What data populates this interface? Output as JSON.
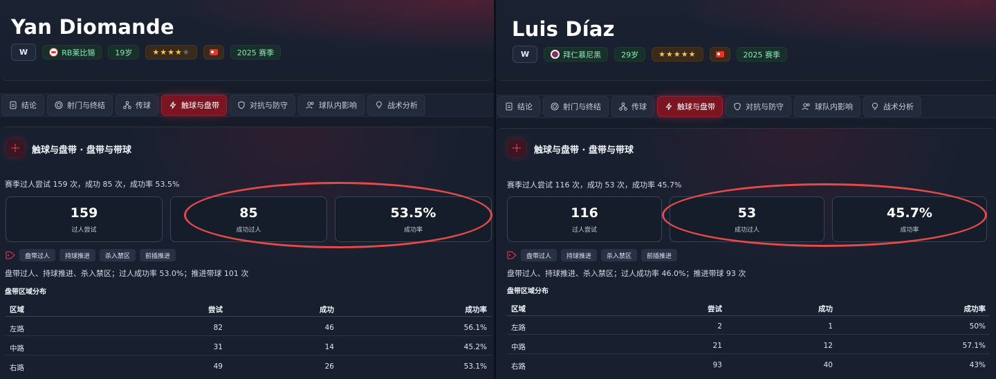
{
  "tabs": [
    {
      "label": "结论",
      "icon": "document-icon"
    },
    {
      "label": "射门与终结",
      "icon": "target-icon"
    },
    {
      "label": "传球",
      "icon": "network-icon"
    },
    {
      "label": "触球与盘带",
      "icon": "lightning-icon"
    },
    {
      "label": "对抗与防守",
      "icon": "shield-icon"
    },
    {
      "label": "球队内影响",
      "icon": "users-icon"
    },
    {
      "label": "战术分析",
      "icon": "lightbulb-icon"
    }
  ],
  "active_tab": "触球与盘带",
  "left": {
    "player": {
      "name": "Yan Diomande",
      "position": "W",
      "club": "RB莱比锡",
      "club_icon": "rb-leipzig-logo-icon",
      "age": "19岁",
      "rating_stars": 4,
      "rating_max": 5,
      "nationality_flag": "germany-flag-icon",
      "season": "2025 赛季"
    },
    "section": {
      "title": "触球与盘带 · 盘带与带球",
      "summary": "赛季过人尝试 159 次，成功 85 次，成功率 53.5%",
      "stats": [
        {
          "value": "159",
          "label": "过人尝试"
        },
        {
          "value": "85",
          "label": "成功过人"
        },
        {
          "value": "53.5%",
          "label": "成功率"
        }
      ],
      "tags": [
        "盘带过人",
        "持球推进",
        "杀入禁区",
        "前插推进"
      ],
      "note": "盘带过人、持球推进、杀入禁区；过人成功率 53.0%；推进带球 101 次",
      "table_title": "盘带区域分布",
      "columns": [
        "区域",
        "尝试",
        "成功",
        "成功率"
      ],
      "rows": [
        [
          "左路",
          "82",
          "46",
          "56.1%"
        ],
        [
          "中路",
          "31",
          "14",
          "45.2%"
        ],
        [
          "右路",
          "49",
          "26",
          "53.1%"
        ]
      ]
    }
  },
  "right": {
    "player": {
      "name": "Luis Díaz",
      "position": "W",
      "club": "拜仁慕尼黑",
      "club_icon": "bayern-munich-logo-icon",
      "age": "29岁",
      "rating_stars": 5,
      "rating_max": 5,
      "nationality_flag": "germany-flag-icon",
      "season": "2025 赛季"
    },
    "section": {
      "title": "触球与盘带 · 盘带与带球",
      "summary": "赛季过人尝试 116 次，成功 53 次，成功率 45.7%",
      "stats": [
        {
          "value": "116",
          "label": "过人尝试"
        },
        {
          "value": "53",
          "label": "成功过人"
        },
        {
          "value": "45.7%",
          "label": "成功率"
        }
      ],
      "tags": [
        "盘带过人",
        "持球推进",
        "杀入禁区",
        "前插推进"
      ],
      "note": "盘带过人、持球推进、杀入禁区；过人成功率 46.0%；推进带球 93 次",
      "table_title": "盘带区域分布",
      "columns": [
        "区域",
        "尝试",
        "成功",
        "成功率"
      ],
      "rows": [
        [
          "左路",
          "2",
          "1",
          "50%"
        ],
        [
          "中路",
          "21",
          "12",
          "57.1%"
        ],
        [
          "右路",
          "93",
          "40",
          "43%"
        ]
      ]
    }
  },
  "colors": {
    "accent_red": "#7c1522",
    "highlight_ellipse": "#e34a4a",
    "chip_green": "#8ee6b6",
    "star_gold": "#f5c84a"
  }
}
